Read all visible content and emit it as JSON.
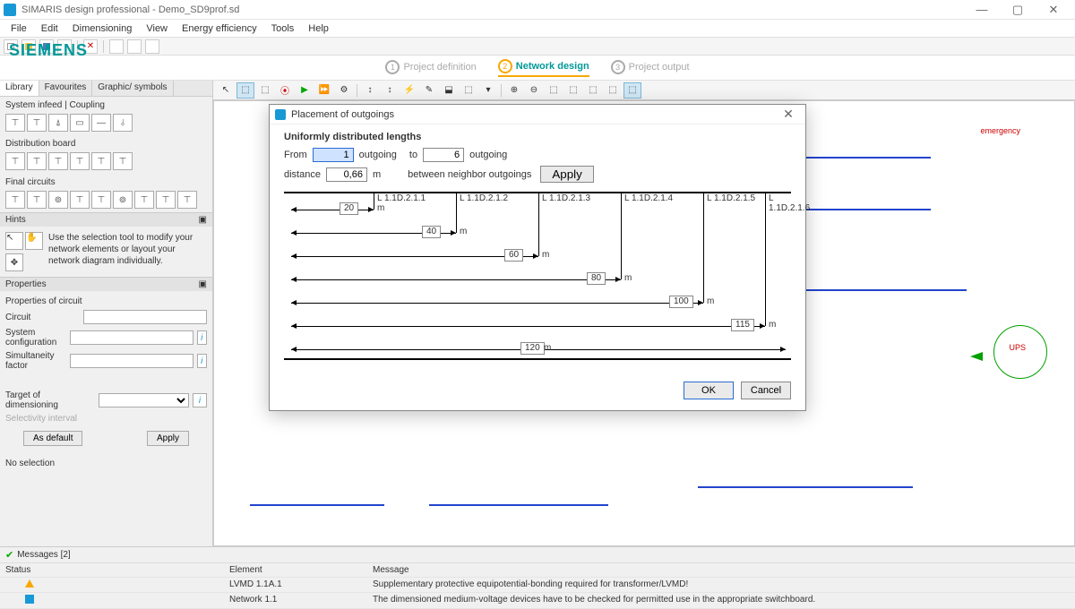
{
  "title": "SIMARIS design professional - Demo_SD9prof.sd",
  "menu": [
    "File",
    "Edit",
    "Dimensioning",
    "View",
    "Energy efficiency",
    "Tools",
    "Help"
  ],
  "brand": "SIEMENS",
  "steps": [
    {
      "n": "1",
      "label": "Project definition"
    },
    {
      "n": "2",
      "label": "Network design"
    },
    {
      "n": "3",
      "label": "Project output"
    }
  ],
  "lib_tabs": [
    "Library",
    "Favourites",
    "Graphic/ symbols"
  ],
  "palette": [
    {
      "title": "System infeed | Coupling",
      "count": 6
    },
    {
      "title": "Distribution board",
      "count": 6
    },
    {
      "title": "Final circuits",
      "count": 9
    }
  ],
  "hints": {
    "title": "Hints",
    "text": "Use the selection tool to modify your network elements or layout your network diagram individually."
  },
  "props": {
    "title": "Properties",
    "header": "Properties of circuit",
    "rows": [
      {
        "label": "Circuit"
      },
      {
        "label": "System configuration",
        "info": true
      },
      {
        "label": "Simultaneity factor",
        "info": true
      }
    ],
    "target": "Target of dimensioning",
    "selectivity": "Selectivity interval",
    "as_default": "As default",
    "apply": "Apply",
    "nosel": "No selection"
  },
  "modal": {
    "title": "Placement of outgoings",
    "heading": "Uniformly distributed lengths",
    "from_lbl": "From",
    "from_val": "1",
    "outgoing_lbl": "outgoing",
    "to_lbl": "to",
    "to_val": "6",
    "outgoing2": "outgoing",
    "dist_lbl": "distance",
    "dist_val": "0,66",
    "m": "m",
    "between": "between neighbor outgoings",
    "apply": "Apply",
    "ok": "OK",
    "cancel": "Cancel",
    "branches": [
      {
        "label": "L 1.1D.2.1.1",
        "dist": "20"
      },
      {
        "label": "L 1.1D.2.1.2",
        "dist": "40"
      },
      {
        "label": "L 1.1D.2.1.3",
        "dist": "60"
      },
      {
        "label": "L 1.1D.2.1.4",
        "dist": "80"
      },
      {
        "label": "L 1.1D.2.1.5",
        "dist": "100"
      },
      {
        "label": "L 1.1D.2.1.6",
        "dist": "115"
      }
    ],
    "total_dist": "120"
  },
  "canvas": {
    "red1": "emergency",
    "ups": "UPS"
  },
  "messages": {
    "title": "Messages [2]",
    "cols": [
      "Status",
      "Element",
      "Message"
    ],
    "rows": [
      {
        "kind": "warn",
        "el": "LVMD 1.1A.1",
        "msg": "Supplementary protective equipotential-bonding required for transformer/LVMD!"
      },
      {
        "kind": "info",
        "el": "Network 1.1",
        "msg": "The dimensioned medium-voltage devices have to be checked for permitted use in the appropriate switchboard."
      }
    ]
  }
}
